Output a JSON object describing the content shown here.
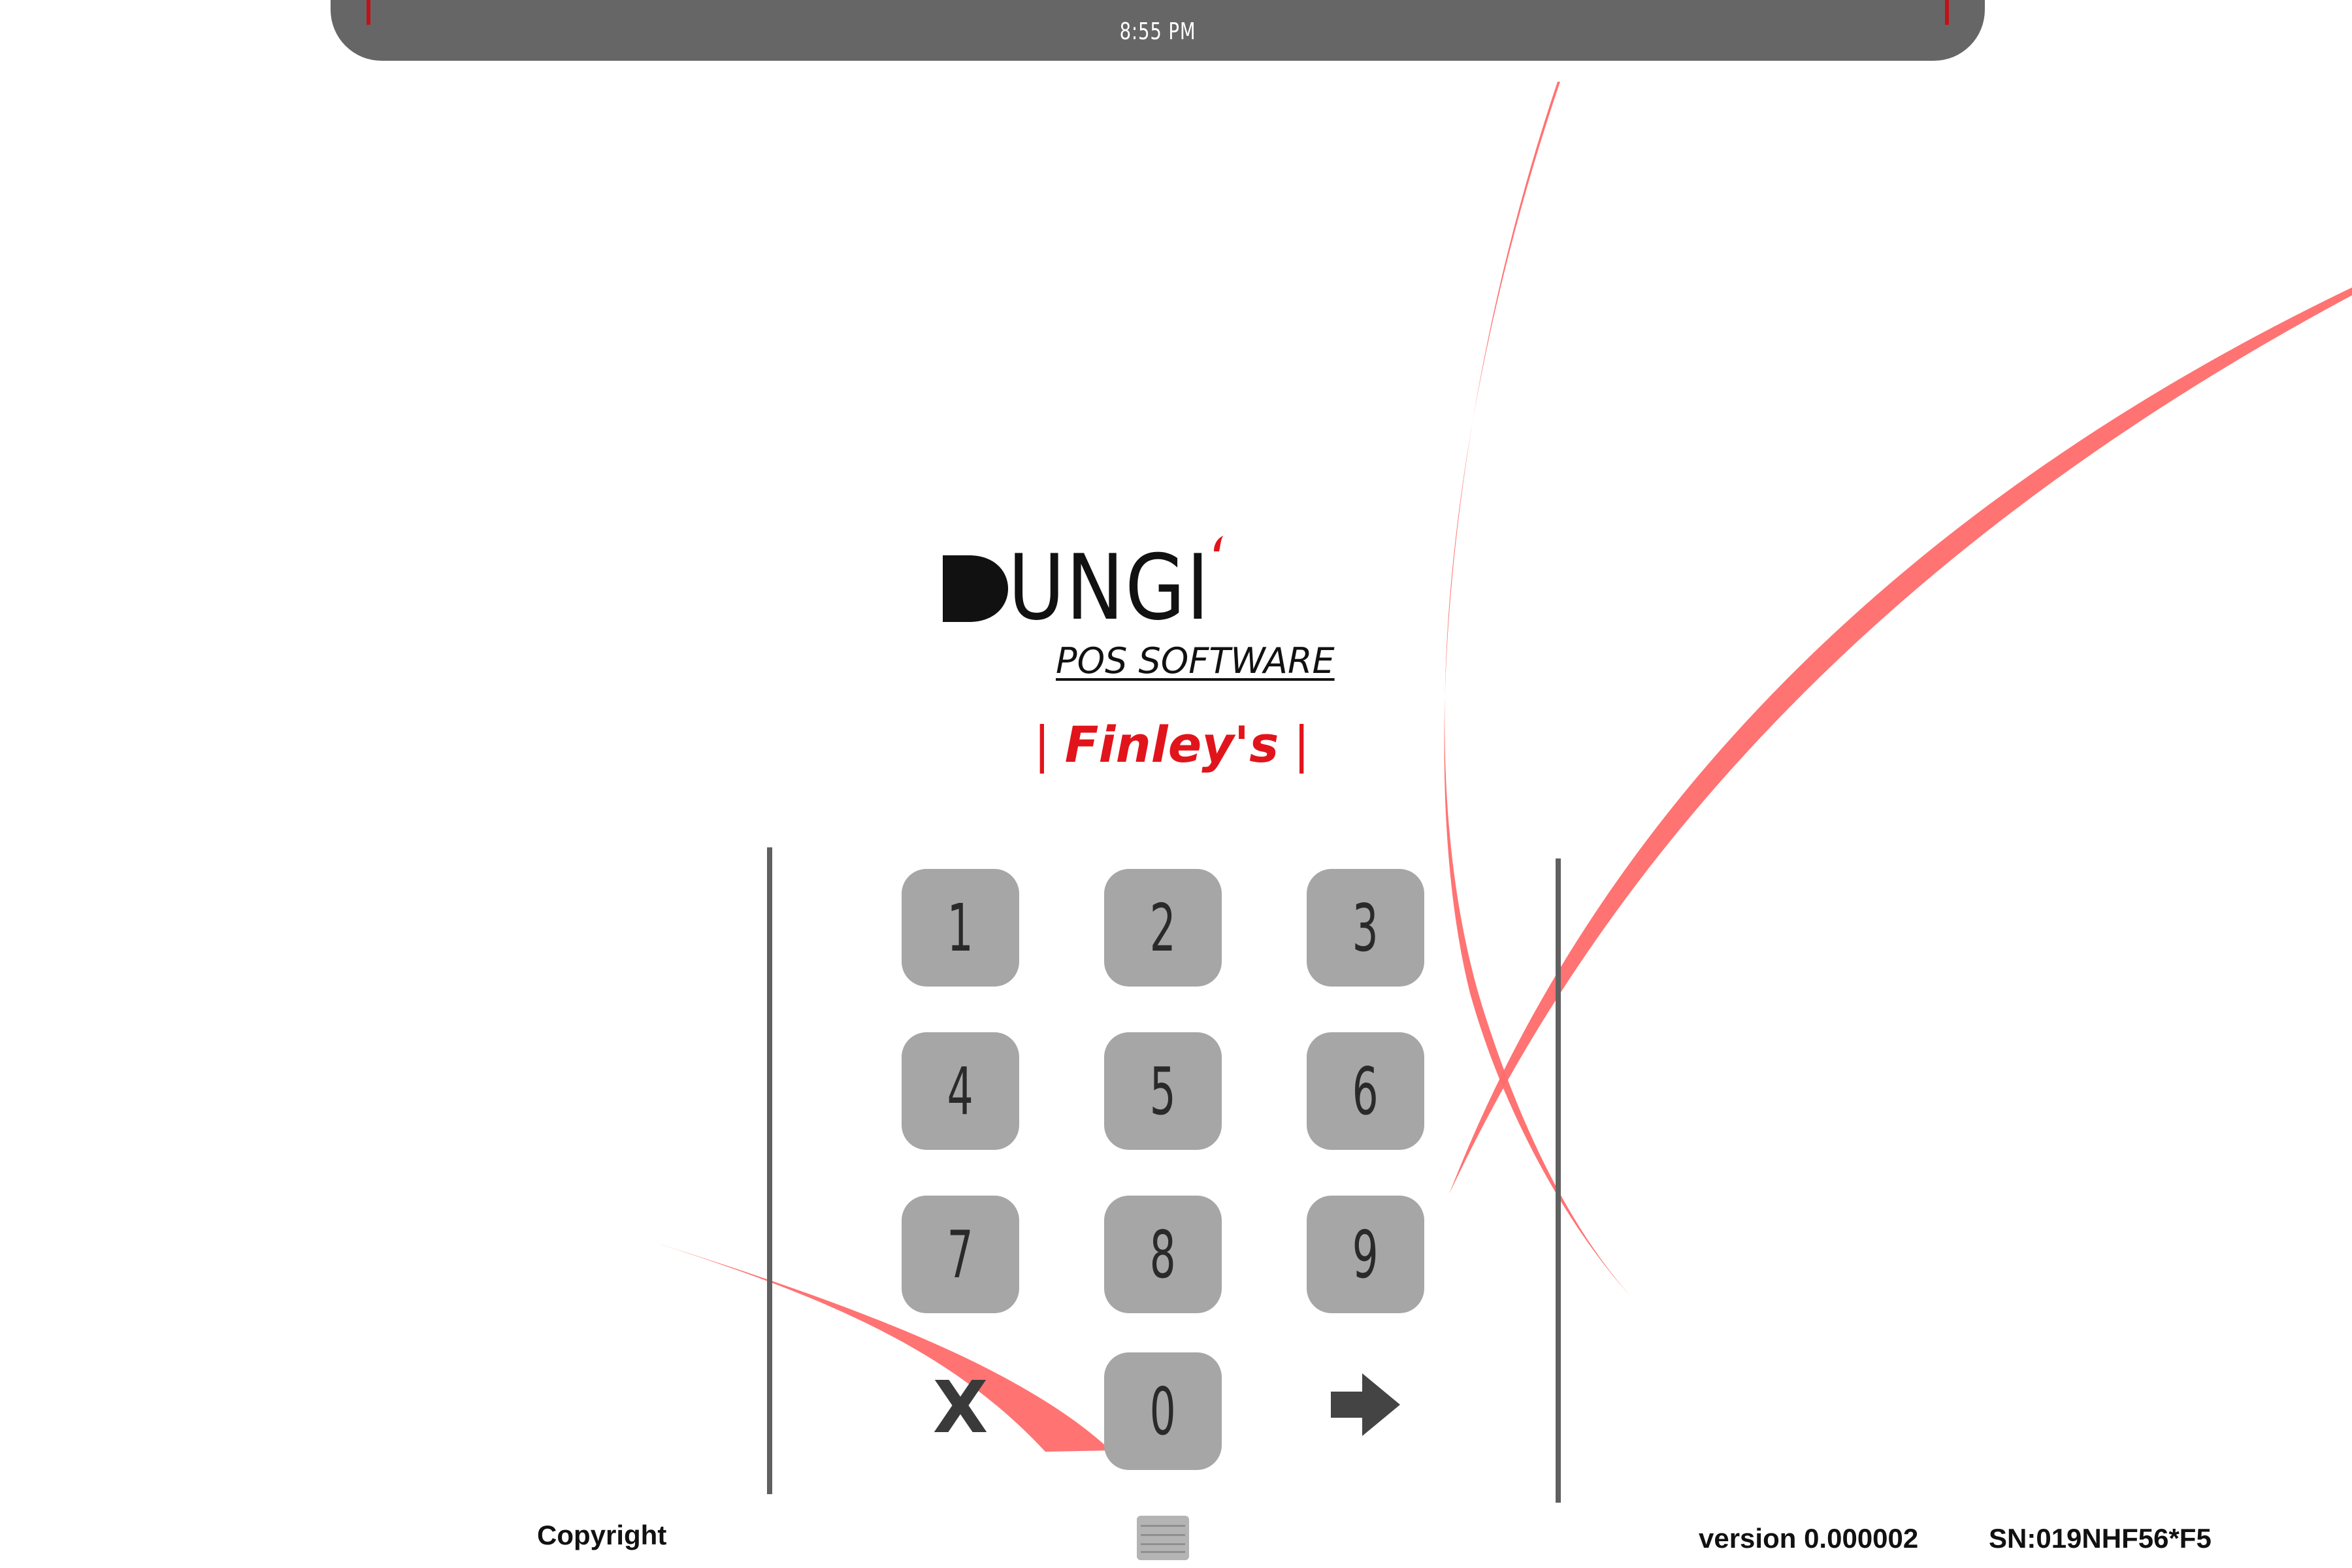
{
  "status_bar": {
    "time": "8:55 PM"
  },
  "brand": {
    "logo": "DUNGI",
    "tagline": "POS SOFTWARE",
    "store_name": "Finley's",
    "separator": "|"
  },
  "keypad": {
    "keys": [
      "1",
      "2",
      "3",
      "4",
      "5",
      "6",
      "7",
      "8",
      "9",
      "0"
    ],
    "clear_label": "X",
    "enter_icon": "arrow-right-icon"
  },
  "footer": {
    "copyright": "Copyright",
    "version": "version 0.000002",
    "serial": "SN:019NHF56*F5",
    "keyboard_icon": "keyboard-icon"
  },
  "colors": {
    "accent": "#e2141b",
    "swoosh": "#ff6b6b",
    "key": "#a6a6a6",
    "bar": "#666666"
  }
}
